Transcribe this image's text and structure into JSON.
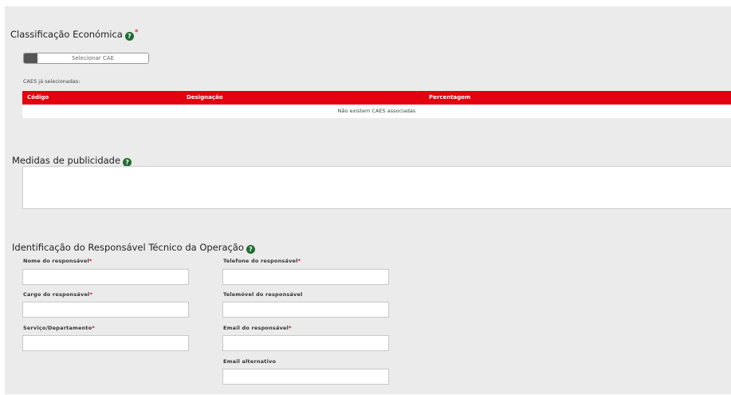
{
  "classificacao": {
    "title": "Classificação Económica",
    "required_mark": "*",
    "select_button": "Selecionar CAE",
    "selected_label": "CAES já selecionadas:",
    "columns": [
      "Código",
      "Designação",
      "Percentagem"
    ],
    "empty_message": "Não existem CAES associadas"
  },
  "publicidade": {
    "title": "Medidas de publicidade",
    "value": ""
  },
  "responsavel": {
    "title": "Identificação do Responsável Técnico da Operação",
    "fields": {
      "nome": {
        "label": "Nome do responsável",
        "required": "*",
        "value": ""
      },
      "cargo": {
        "label": "Cargo do responsável",
        "required": "*",
        "value": ""
      },
      "servico": {
        "label": "Serviço/Departamento",
        "required": "*",
        "value": ""
      },
      "telefone": {
        "label": "Telefone do responsável",
        "required": "*",
        "value": ""
      },
      "telemovel": {
        "label": "Telemóvel do responsável",
        "value": ""
      },
      "email": {
        "label": "Email do responsável",
        "required": "*",
        "value": ""
      },
      "email_alt": {
        "label": "Email alternativo",
        "value": ""
      }
    }
  },
  "icons": {
    "help": "?"
  },
  "colors": {
    "accent": "#e3000f",
    "help_icon": "#1f6b2f",
    "panel_bg": "#ebebeb"
  }
}
